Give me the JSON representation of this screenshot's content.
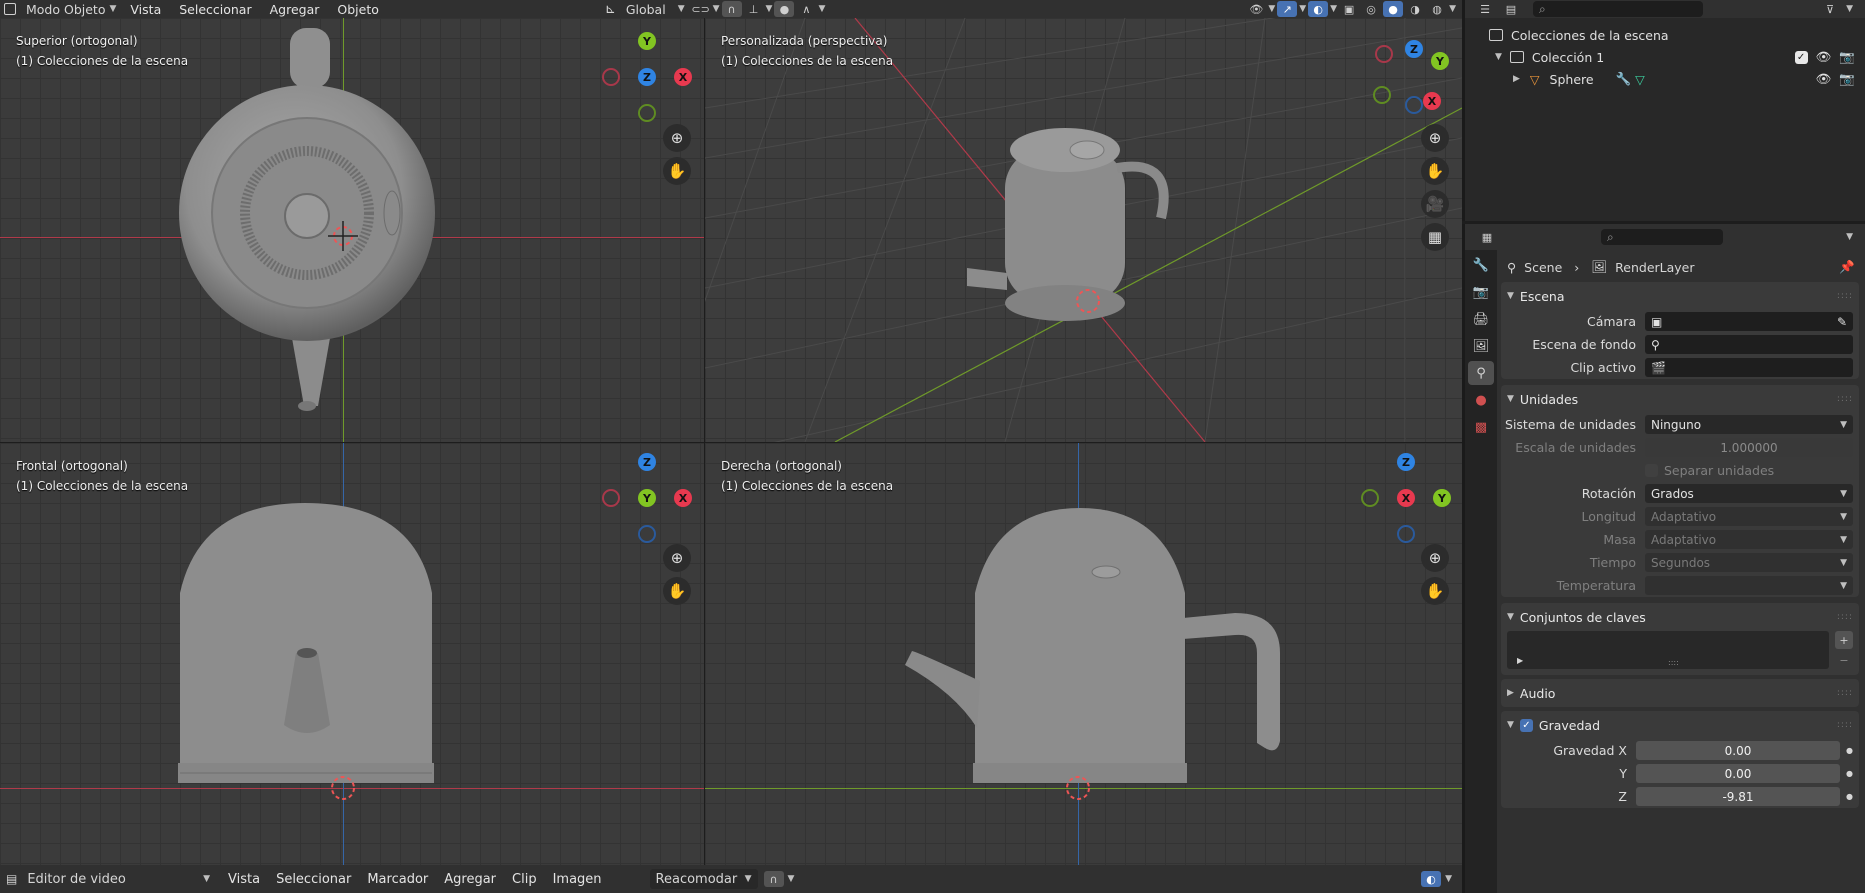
{
  "header": {
    "mode": "Modo Objeto",
    "menus": [
      "Vista",
      "Seleccionar",
      "Agregar",
      "Objeto"
    ],
    "orientation": "Global"
  },
  "viewports": [
    {
      "title": "Superior (ortogonal)",
      "subtitle": "(1) Colecciones de la escena"
    },
    {
      "title": "Personalizada (perspectiva)",
      "subtitle": "(1) Colecciones de la escena"
    },
    {
      "title": "Frontal (ortogonal)",
      "subtitle": "(1) Colecciones de la escena"
    },
    {
      "title": "Derecha (ortogonal)",
      "subtitle": "(1) Colecciones de la escena"
    }
  ],
  "gizmo": {
    "x": "X",
    "y": "Y",
    "z": "Z"
  },
  "outliner": {
    "root": "Colecciones de la escena",
    "collection": "Colección 1",
    "object": "Sphere"
  },
  "properties": {
    "breadcrumb": {
      "scene": "Scene",
      "layer": "RenderLayer"
    },
    "escena": {
      "title": "Escena",
      "camera_label": "Cámara",
      "background_label": "Escena de fondo",
      "clip_label": "Clip activo"
    },
    "unidades": {
      "title": "Unidades",
      "system_label": "Sistema de unidades",
      "system_value": "Ninguno",
      "scale_label": "Escala de unidades",
      "scale_value": "1.000000",
      "separate_label": "Separar unidades",
      "rotation_label": "Rotación",
      "rotation_value": "Grados",
      "length_label": "Longitud",
      "length_value": "Adaptativo",
      "mass_label": "Masa",
      "mass_value": "Adaptativo",
      "time_label": "Tiempo",
      "time_value": "Segundos",
      "temp_label": "Temperatura",
      "temp_value": ""
    },
    "keying": {
      "title": "Conjuntos de claves"
    },
    "audio": {
      "title": "Audio"
    },
    "gravity": {
      "title": "Gravedad",
      "x_label": "Gravedad X",
      "x_value": "0.00",
      "y_label": "Y",
      "y_value": "0.00",
      "z_label": "Z",
      "z_value": "-9.81"
    }
  },
  "bottom_bar": {
    "editor": "Editor de video",
    "menus": [
      "Vista",
      "Seleccionar",
      "Marcador",
      "Agregar",
      "Clip",
      "Imagen"
    ],
    "pivot": "Reacomodar"
  },
  "colors": {
    "x_axis": "#e8394f",
    "y_axis": "#82c522",
    "z_axis": "#2f84e3",
    "accent": "#4772b3"
  }
}
